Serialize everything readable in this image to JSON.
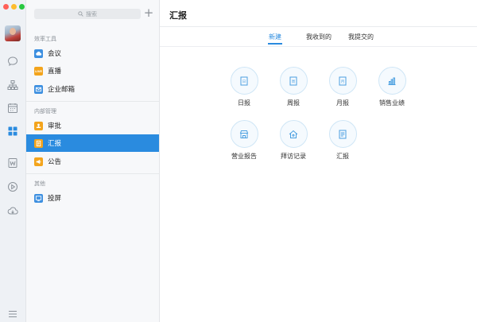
{
  "window": {
    "traffic_colors": [
      "#ff5f57",
      "#febc2e",
      "#28c840"
    ]
  },
  "rail": {
    "icons": [
      "chat-icon",
      "org-chart-icon",
      "calendar-icon",
      "workbench-grid-icon",
      "document-w-icon",
      "play-icon",
      "cloud-icon",
      "menu-icon"
    ]
  },
  "sidebar": {
    "search_placeholder": "搜索",
    "add_label": "+",
    "sections": [
      {
        "title": "效率工具",
        "items": [
          {
            "label": "会议",
            "icon": "cloud-meeting-icon",
            "color": "#3d8fe0"
          },
          {
            "label": "直播",
            "icon": "live-icon",
            "color": "#f3a41c"
          },
          {
            "label": "企业邮箱",
            "icon": "mail-icon",
            "color": "#3d8fe0"
          }
        ]
      },
      {
        "title": "内部管理",
        "items": [
          {
            "label": "审批",
            "icon": "approval-icon",
            "color": "#f3a41c"
          },
          {
            "label": "汇报",
            "icon": "report-icon",
            "color": "#f3a41c",
            "active": true
          },
          {
            "label": "公告",
            "icon": "announcement-icon",
            "color": "#f3a41c"
          }
        ]
      },
      {
        "title": "其他",
        "items": [
          {
            "label": "投屏",
            "icon": "screen-cast-icon",
            "color": "#3d8fe0"
          }
        ]
      }
    ],
    "active_color": "#2a8bdf"
  },
  "main": {
    "title": "汇报",
    "tabs": [
      {
        "label": "新建",
        "active": true
      },
      {
        "label": "我收到的",
        "active": false
      },
      {
        "label": "我提交的",
        "active": false
      }
    ],
    "templates": [
      {
        "label": "日报",
        "icon": "daily-report-icon"
      },
      {
        "label": "周报",
        "icon": "weekly-report-icon"
      },
      {
        "label": "月报",
        "icon": "monthly-report-icon"
      },
      {
        "label": "销售业绩",
        "icon": "sales-chart-icon"
      },
      {
        "label": "营业报告",
        "icon": "store-icon"
      },
      {
        "label": "拜访记录",
        "icon": "visit-home-icon"
      },
      {
        "label": "汇报",
        "icon": "report-doc-icon"
      }
    ]
  }
}
